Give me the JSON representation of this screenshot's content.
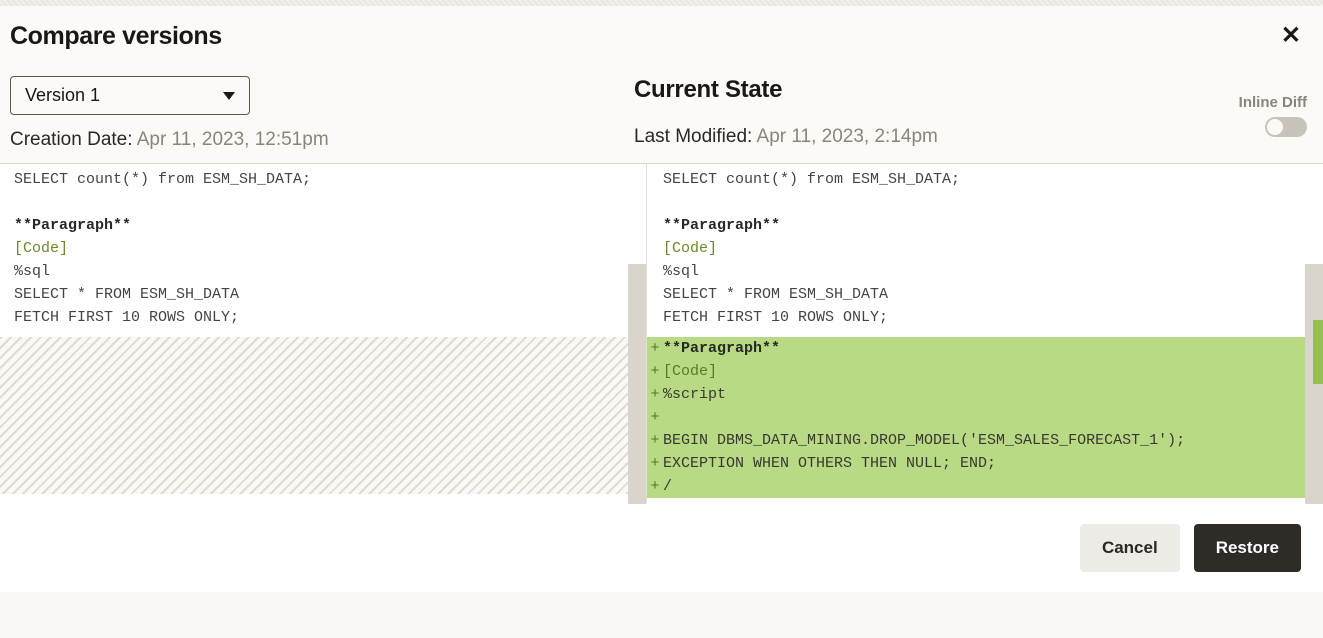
{
  "dialog": {
    "title": "Compare versions"
  },
  "left": {
    "version_selected": "Version 1",
    "creation_label": "Creation Date: ",
    "creation_value": "Apr 11, 2023, 12:51pm",
    "lines": {
      "l1": "SELECT count(*) from ESM_SH_DATA;",
      "l2": "**Paragraph**",
      "l3": "[Code]",
      "l4": "%sql",
      "l5": "SELECT * FROM ESM_SH_DATA",
      "l6": "FETCH FIRST 10 ROWS ONLY;"
    }
  },
  "right": {
    "heading": "Current State",
    "modified_label": "Last Modified: ",
    "modified_value": "Apr 11, 2023, 2:14pm",
    "inline_diff_label": "Inline Diff",
    "lines": {
      "l1": "SELECT count(*) from ESM_SH_DATA;",
      "l2": "**Paragraph**",
      "l3": "[Code]",
      "l4": "%sql",
      "l5": "SELECT * FROM ESM_SH_DATA",
      "l6": "FETCH FIRST 10 ROWS ONLY;"
    },
    "added": {
      "a1": "**Paragraph**",
      "a2": "[Code]",
      "a3": "%script",
      "a4": "",
      "a5": "BEGIN DBMS_DATA_MINING.DROP_MODEL('ESM_SALES_FORECAST_1');",
      "a6": "EXCEPTION WHEN OTHERS THEN NULL; END;",
      "a7": "/"
    }
  },
  "footer": {
    "cancel": "Cancel",
    "restore": "Restore"
  }
}
